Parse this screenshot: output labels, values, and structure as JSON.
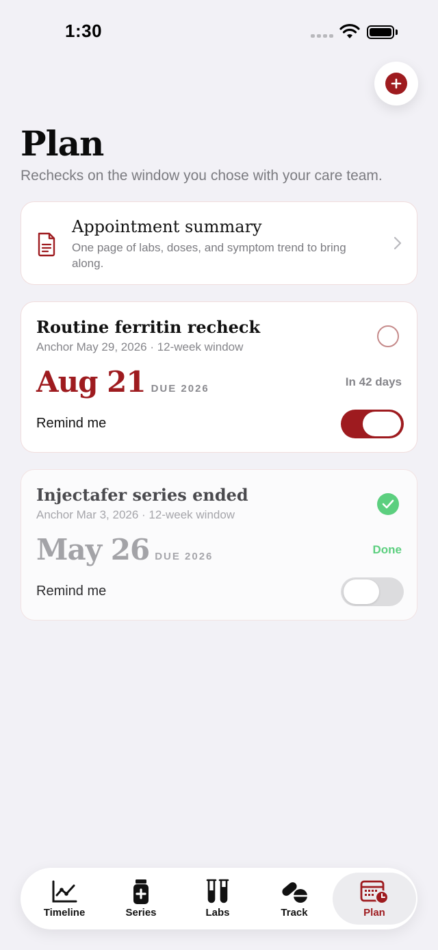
{
  "status_bar": {
    "time": "1:30"
  },
  "header": {
    "title": "Plan",
    "subtitle": "Rechecks on the window you chose with your care team."
  },
  "summary_card": {
    "title": "Appointment summary",
    "description": "One page of labs, doses, and symptom trend to bring along."
  },
  "plan_items": [
    {
      "title": "Routine ferritin recheck",
      "anchor": "Anchor May 29, 2026 · 12-week window",
      "due_date": "Aug 21",
      "due_label": "DUE 2026",
      "status": "In 42 days",
      "completed": false,
      "remind_label": "Remind me",
      "remind_enabled": true
    },
    {
      "title": "Injectafer series ended",
      "anchor": "Anchor Mar 3, 2026 · 12-week window",
      "due_date": "May 26",
      "due_label": "DUE 2026",
      "status": "Done",
      "completed": true,
      "remind_label": "Remind me",
      "remind_enabled": false
    }
  ],
  "tab_bar": {
    "tabs": [
      {
        "label": "Timeline",
        "icon": "chart-line-icon",
        "active": false
      },
      {
        "label": "Series",
        "icon": "medicine-vial-icon",
        "active": false
      },
      {
        "label": "Labs",
        "icon": "test-tubes-icon",
        "active": false
      },
      {
        "label": "Track",
        "icon": "pills-icon",
        "active": false
      },
      {
        "label": "Plan",
        "icon": "calendar-clock-icon",
        "active": true
      }
    ]
  },
  "colors": {
    "accent": "#9e1b1f",
    "success": "#5ccf7f",
    "background": "#f2f1f6"
  }
}
